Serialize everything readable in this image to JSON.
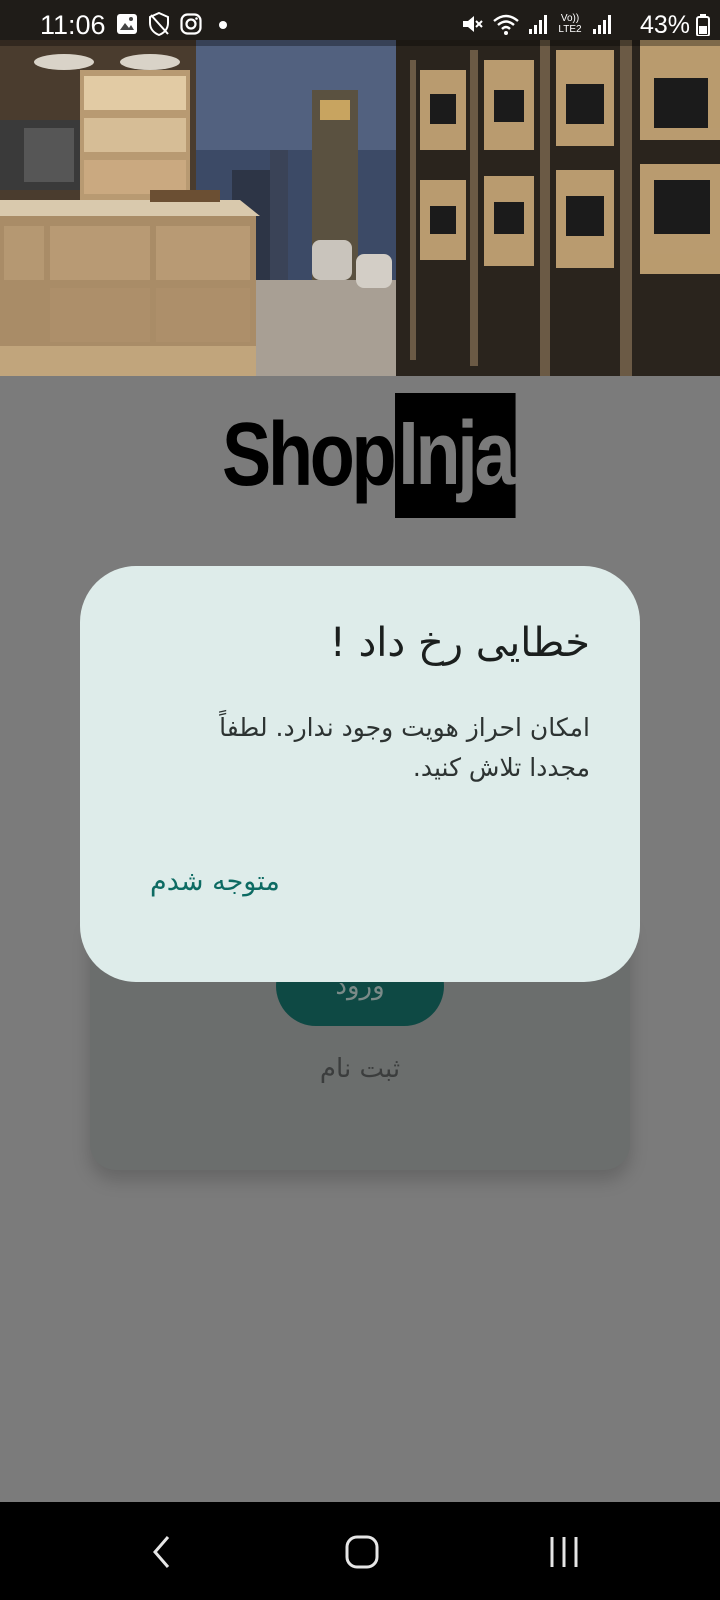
{
  "status_bar": {
    "time": "11:06",
    "battery": "43%",
    "icons_left": [
      "gallery-icon",
      "shield-icon",
      "instagram-icon",
      "dot-icon"
    ],
    "icons_right": [
      "mute-icon",
      "wifi-icon",
      "signal-icon",
      "volte-icon",
      "signal-icon-2",
      "battery-icon"
    ],
    "volte_label": "Vo)) LTE2"
  },
  "logo": {
    "part1": "Shop",
    "part2": "Inja"
  },
  "login": {
    "login_label": "ورود",
    "signup_label": "ثبت نام"
  },
  "dialog": {
    "title": "خطایی رخ داد !",
    "message": "امکان احراز هویت وجود ندارد. لطفاً مجددا تلاش کنید.",
    "action_label": "متوجه شدم"
  },
  "nav": {
    "items": [
      "back-icon",
      "home-icon",
      "recents-icon"
    ]
  },
  "colors": {
    "scrim": "#7b7b7b",
    "dialog_bg": "#deecea",
    "accent": "#0d6b63",
    "login_button": "#0e4944"
  }
}
